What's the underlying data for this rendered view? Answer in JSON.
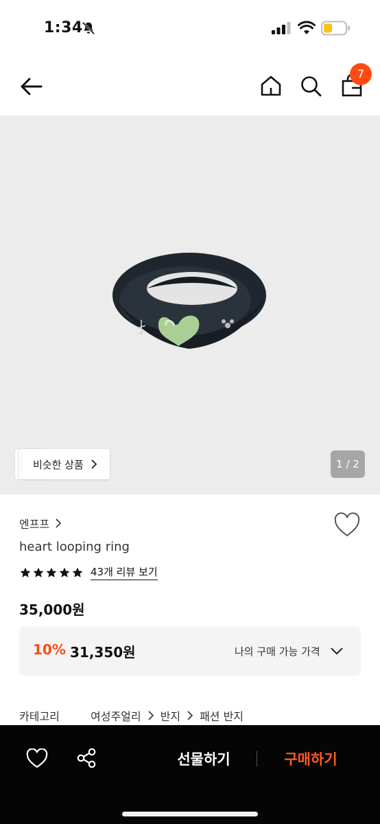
{
  "status_bar": {
    "time": "1:34"
  },
  "nav": {
    "cart_count": "7"
  },
  "gallery": {
    "similar_label": "비슷한 상품",
    "page_indicator": "1 / 2"
  },
  "product": {
    "brand": "엔프프",
    "name": "heart looping ring",
    "rating": 5,
    "review_link": "43개 리뷰 보기",
    "original_price": "35,000원",
    "discount_rate": "10%",
    "sale_price": "31,350원",
    "my_price_label": "나의 구매 가능 가격"
  },
  "category": {
    "label": "카테고리",
    "path": [
      "여성주얼리",
      "반지",
      "패션 반지"
    ]
  },
  "bottom_bar": {
    "gift_label": "선물하기",
    "buy_label": "구매하기"
  },
  "colors": {
    "accent": "#ff4b12",
    "bar_background": "#050505",
    "ring": "#1f262e",
    "heart_stone": "#a9cf95"
  },
  "icons": [
    "bell-muted-icon",
    "signal-icon",
    "wifi-icon",
    "battery-icon",
    "back-arrow-icon",
    "home-icon",
    "search-icon",
    "shopping-bag-icon",
    "heart-icon",
    "star-icon",
    "chevron-right-icon",
    "chevron-down-icon",
    "share-icon"
  ]
}
